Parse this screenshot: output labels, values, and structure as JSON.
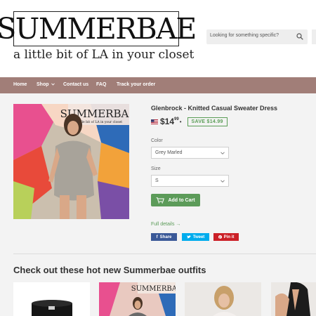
{
  "header": {
    "logo_text": "SUMMERBAE",
    "tagline": "a little bit of LA in your closet",
    "search_placeholder": "Looking for something specific?"
  },
  "nav": {
    "items": [
      "Home",
      "Shop",
      "Contact us",
      "FAQ",
      "Track your order"
    ]
  },
  "product": {
    "title": "Glenbrock - Knitted Casual Sweater Dress",
    "price_main": "$14",
    "price_cents": "99",
    "price_suffix": "•",
    "save_badge": "SAVE $14.99",
    "image_logo_text": "SUMMERBAE",
    "image_tagline": "a little bit of LA in your closet",
    "color_label": "Color",
    "color_value": "Grey Marled",
    "size_label": "Size",
    "size_value": "S",
    "add_to_cart": "Add to Cart",
    "full_details": "Full details →"
  },
  "share": {
    "facebook": "Share",
    "twitter": "Tweet",
    "pinterest": "Pin it"
  },
  "section": {
    "title": "Check out these hot new Summerbae outfits"
  },
  "thumbs": {
    "logo_text": "SUMMERBAE"
  },
  "colors": {
    "nav_bg": "#a17e78",
    "button_green": "#5c9b59",
    "facebook": "#3b5998",
    "twitter": "#00aced",
    "pinterest": "#cb2027"
  }
}
